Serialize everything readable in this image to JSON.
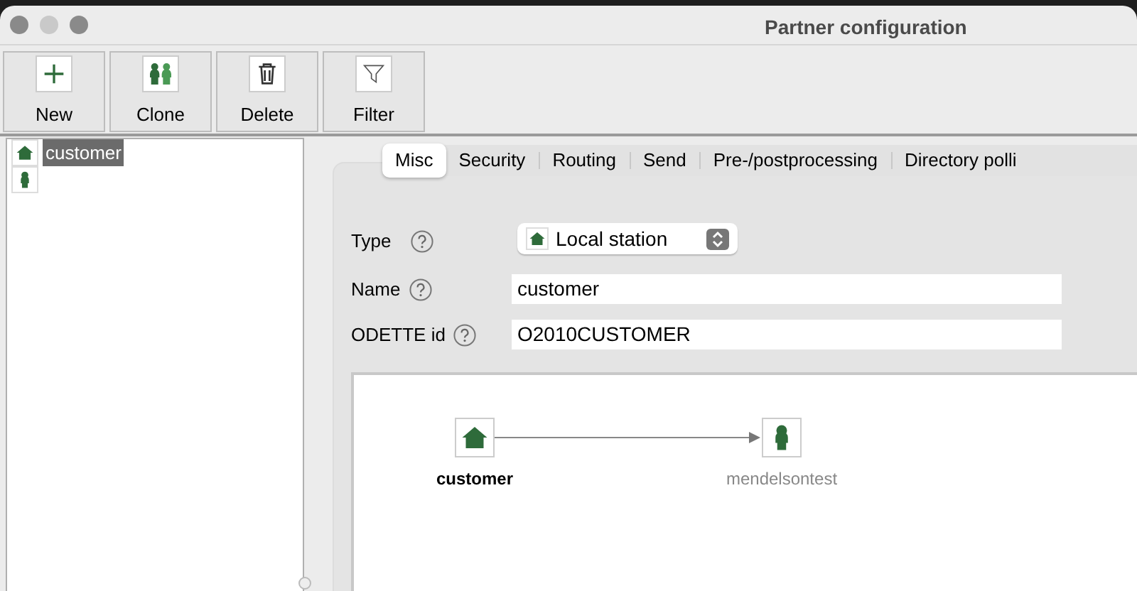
{
  "window": {
    "title": "Partner configuration"
  },
  "toolbar": [
    {
      "label": "New",
      "kind": "new"
    },
    {
      "label": "Clone",
      "kind": "clone"
    },
    {
      "label": "Delete",
      "kind": "delete"
    },
    {
      "label": "Filter",
      "kind": "filter"
    }
  ],
  "tree": [
    {
      "label": "customer",
      "kind": "local",
      "selected": true
    },
    {
      "kind": "partner",
      "selected": false
    }
  ],
  "tabs": [
    {
      "label": "Misc",
      "selected": true
    },
    {
      "label": "Security",
      "selected": false
    },
    {
      "label": "Routing",
      "selected": false
    },
    {
      "label": "Send",
      "selected": false
    },
    {
      "label": "Pre-/postprocessing",
      "selected": false
    },
    {
      "label": "Directory polli",
      "selected": false
    }
  ],
  "form": {
    "type": {
      "label": "Type",
      "value": "Local station",
      "kind": "local"
    },
    "fields": [
      {
        "label": "Name",
        "value": "customer"
      },
      {
        "label": "ODETTE id",
        "value": "O2010CUSTOMER"
      }
    ]
  },
  "diagram": {
    "nodes": [
      {
        "label": "customer",
        "kind": "local"
      },
      {
        "label": "mendelsontest",
        "kind": "partner"
      }
    ]
  }
}
